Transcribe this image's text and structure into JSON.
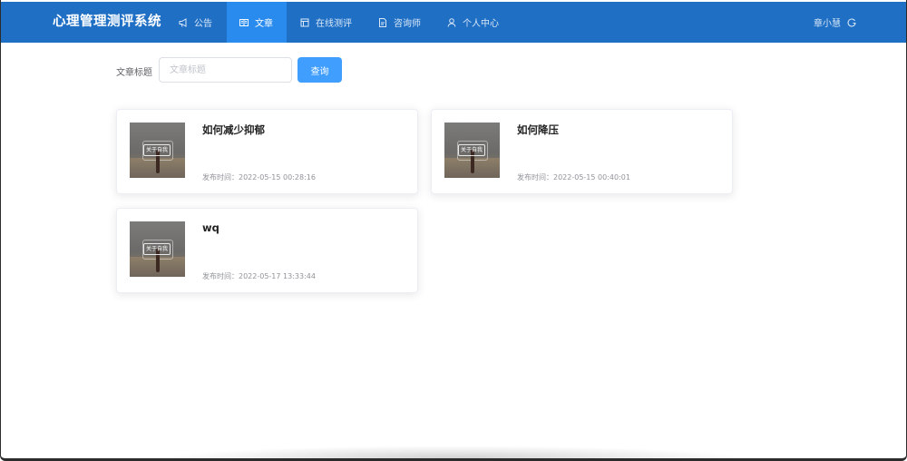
{
  "app": {
    "title": "心理管理测评系统"
  },
  "nav": {
    "items": [
      {
        "label": "公告",
        "icon": "megaphone-icon",
        "active": false
      },
      {
        "label": "文章",
        "icon": "book-icon",
        "active": true
      },
      {
        "label": "在线测评",
        "icon": "form-icon",
        "active": false
      },
      {
        "label": "咨询师",
        "icon": "document-icon",
        "active": false
      },
      {
        "label": "个人中心",
        "icon": "user-icon",
        "active": false
      }
    ],
    "user": {
      "name": "章小慧",
      "logout_icon": "logout-icon"
    }
  },
  "search": {
    "label": "文章标题",
    "placeholder": "文章标题",
    "value": "",
    "button_label": "查询"
  },
  "articles": [
    {
      "title": "如何减少抑郁",
      "time_label": "发布时间：2022-05-15 00:28:16",
      "thumb_tag": "关于自我"
    },
    {
      "title": "如何降压",
      "time_label": "发布时间：2022-05-15 00:40:01",
      "thumb_tag": "关于自我"
    },
    {
      "title": "wq",
      "time_label": "发布时间：2022-05-17 13:33:44",
      "thumb_tag": "关于自我"
    }
  ],
  "colors": {
    "navbar": "#1f6fc5",
    "nav_active": "#2a8bef",
    "primary_button": "#409eff"
  }
}
